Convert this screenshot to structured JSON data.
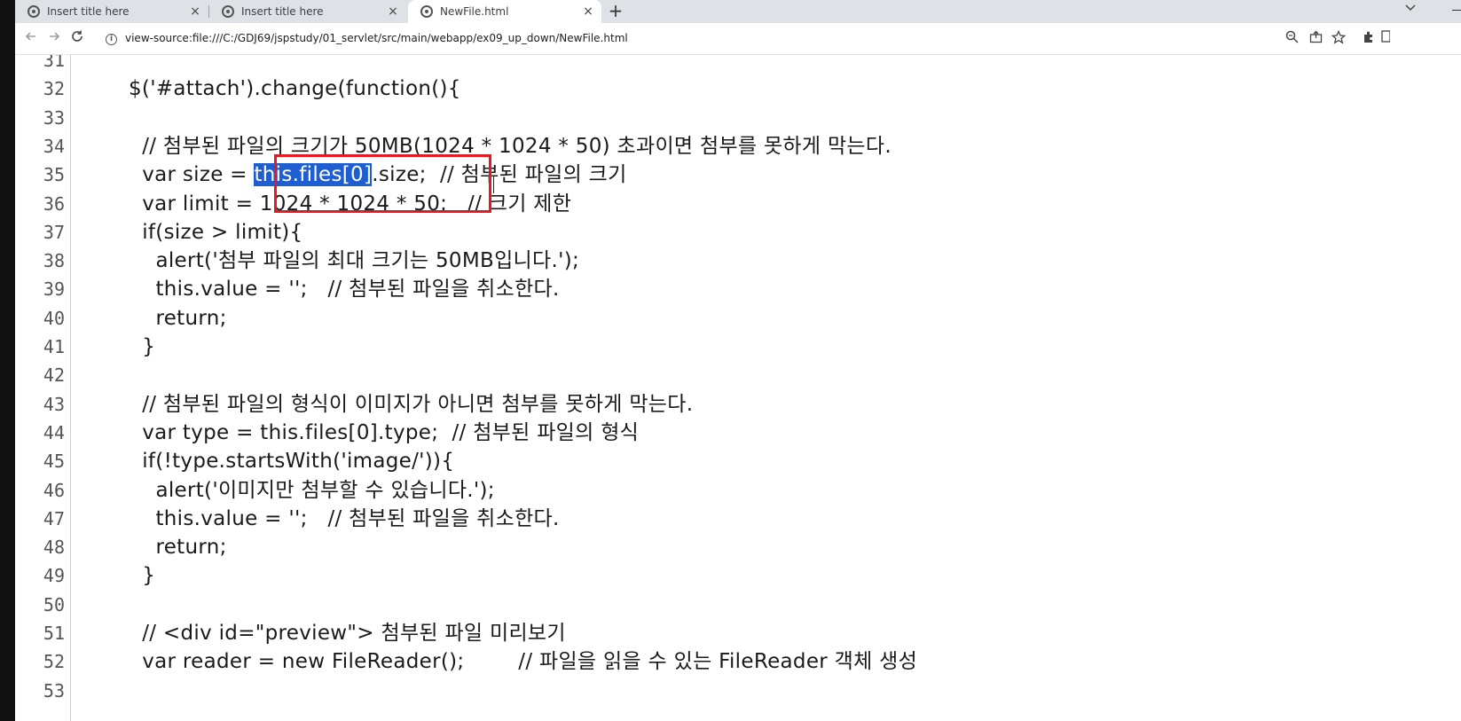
{
  "tabs": [
    {
      "label": "Insert title here",
      "close": "×"
    },
    {
      "label": "Insert title here",
      "close": "×"
    },
    {
      "label": "NewFile.html",
      "close": "×"
    }
  ],
  "new_tab": "+",
  "address": {
    "url": "view-source:file:///C:/GDJ69/jspstudy/01_servlet/src/main/webapp/ex09_up_down/NewFile.html"
  },
  "toolbar_icons": [
    "back-arrow-icon",
    "forward-arrow-icon",
    "reload-icon",
    "info-icon",
    "zoom-icon",
    "share-icon",
    "star-icon",
    "extensions-icon"
  ],
  "code_lines": [
    {
      "n": "31",
      "pre": "",
      "sel": "",
      "post": ""
    },
    {
      "n": "32",
      "pre": "$('#attach').change(function(){",
      "sel": "",
      "post": ""
    },
    {
      "n": "33",
      "pre": "",
      "sel": "",
      "post": ""
    },
    {
      "n": "34",
      "pre": "  // 첨부된 파일의 크기가 50MB(1024 * 1024 * 50) 초과이면 첨부를 못하게 막는다.",
      "sel": "",
      "post": ""
    },
    {
      "n": "35",
      "pre": "  var size = ",
      "sel": "this.files[0]",
      "post": ".size;  // 첨부된 파일의 크기"
    },
    {
      "n": "36",
      "pre": "  var limit = 1024 * 1024 * 50;   // 크기 제한",
      "sel": "",
      "post": ""
    },
    {
      "n": "37",
      "pre": "  if(size > limit){",
      "sel": "",
      "post": ""
    },
    {
      "n": "38",
      "pre": "    alert('첨부 파일의 최대 크기는 50MB입니다.');",
      "sel": "",
      "post": ""
    },
    {
      "n": "39",
      "pre": "    this.value = '';   // 첨부된 파일을 취소한다.",
      "sel": "",
      "post": ""
    },
    {
      "n": "40",
      "pre": "    return;",
      "sel": "",
      "post": ""
    },
    {
      "n": "41",
      "pre": "  }",
      "sel": "",
      "post": ""
    },
    {
      "n": "42",
      "pre": "",
      "sel": "",
      "post": ""
    },
    {
      "n": "43",
      "pre": "  // 첨부된 파일의 형식이 이미지가 아니면 첨부를 못하게 막는다.",
      "sel": "",
      "post": ""
    },
    {
      "n": "44",
      "pre": "  var type = this.files[0].type;  // 첨부된 파일의 형식",
      "sel": "",
      "post": ""
    },
    {
      "n": "45",
      "pre": "  if(!type.startsWith('image/')){",
      "sel": "",
      "post": ""
    },
    {
      "n": "46",
      "pre": "    alert('이미지만 첨부할 수 있습니다.');",
      "sel": "",
      "post": ""
    },
    {
      "n": "47",
      "pre": "    this.value = '';   // 첨부된 파일을 취소한다.",
      "sel": "",
      "post": ""
    },
    {
      "n": "48",
      "pre": "    return;",
      "sel": "",
      "post": ""
    },
    {
      "n": "49",
      "pre": "  }",
      "sel": "",
      "post": ""
    },
    {
      "n": "50",
      "pre": "",
      "sel": "",
      "post": ""
    },
    {
      "n": "51",
      "pre": "  // <div id=\"preview\"> 첨부된 파일 미리보기",
      "sel": "",
      "post": ""
    },
    {
      "n": "52",
      "pre": "  var reader = new FileReader();        // 파일을 읽을 수 있는 FileReader 객체 생성",
      "sel": "",
      "post": ""
    },
    {
      "n": "53",
      "pre": "",
      "sel": "",
      "post": ""
    }
  ]
}
